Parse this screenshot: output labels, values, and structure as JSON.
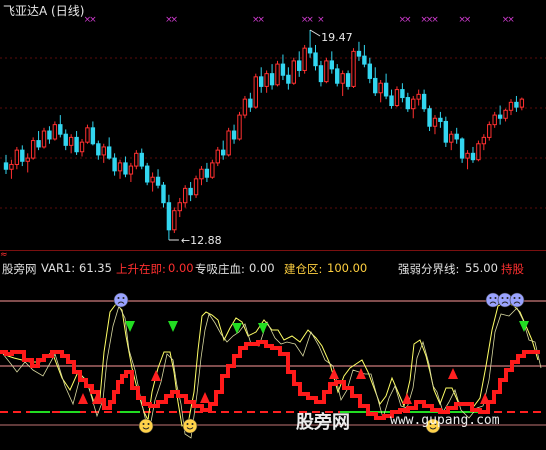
{
  "header": {
    "stock_name": "飞亚达A",
    "period": "(日线)"
  },
  "price_chart": {
    "high_label": "19.47",
    "low_label": "12.88",
    "colors": {
      "up": "#ff3030",
      "down": "#33d6f0",
      "marker": "#d03cd0"
    },
    "candles": [
      [
        15.3,
        15.55,
        14.95,
        15.1
      ],
      [
        15.1,
        15.4,
        14.8,
        15.25
      ],
      [
        15.25,
        15.8,
        15.1,
        15.7
      ],
      [
        15.7,
        15.85,
        15.2,
        15.35
      ],
      [
        15.35,
        15.6,
        15.0,
        15.45
      ],
      [
        15.45,
        16.1,
        15.4,
        16.0
      ],
      [
        16.0,
        16.3,
        15.7,
        15.8
      ],
      [
        15.8,
        16.4,
        15.75,
        16.3
      ],
      [
        16.3,
        16.45,
        15.9,
        16.05
      ],
      [
        16.05,
        16.6,
        16.0,
        16.5
      ],
      [
        16.5,
        16.8,
        16.1,
        16.2
      ],
      [
        16.2,
        16.35,
        15.7,
        15.85
      ],
      [
        15.85,
        16.2,
        15.6,
        16.1
      ],
      [
        16.1,
        16.3,
        15.55,
        15.65
      ],
      [
        15.65,
        16.05,
        15.5,
        15.95
      ],
      [
        15.95,
        16.5,
        15.9,
        16.4
      ],
      [
        16.4,
        16.6,
        15.85,
        15.9
      ],
      [
        15.9,
        16.0,
        15.4,
        15.55
      ],
      [
        15.55,
        15.9,
        15.3,
        15.8
      ],
      [
        15.8,
        16.1,
        15.4,
        15.45
      ],
      [
        15.45,
        15.6,
        14.9,
        15.05
      ],
      [
        15.05,
        15.4,
        14.8,
        15.3
      ],
      [
        15.3,
        15.5,
        14.85,
        14.95
      ],
      [
        14.95,
        15.3,
        14.7,
        15.2
      ],
      [
        15.2,
        15.7,
        15.1,
        15.6
      ],
      [
        15.6,
        15.75,
        15.1,
        15.2
      ],
      [
        15.2,
        15.3,
        14.6,
        14.7
      ],
      [
        14.7,
        15.0,
        14.4,
        14.85
      ],
      [
        14.85,
        15.1,
        14.5,
        14.6
      ],
      [
        14.6,
        14.7,
        13.9,
        14.05
      ],
      [
        14.05,
        14.3,
        12.88,
        13.2
      ],
      [
        13.2,
        13.9,
        13.1,
        13.8
      ],
      [
        13.8,
        14.2,
        13.6,
        14.05
      ],
      [
        14.05,
        14.6,
        13.9,
        14.5
      ],
      [
        14.5,
        14.7,
        14.1,
        14.3
      ],
      [
        14.3,
        14.9,
        14.2,
        14.8
      ],
      [
        14.8,
        15.2,
        14.6,
        15.1
      ],
      [
        15.1,
        15.3,
        14.7,
        14.85
      ],
      [
        14.85,
        15.4,
        14.8,
        15.3
      ],
      [
        15.3,
        15.8,
        15.2,
        15.7
      ],
      [
        15.7,
        16.0,
        15.4,
        15.55
      ],
      [
        15.55,
        16.4,
        15.5,
        16.3
      ],
      [
        16.3,
        16.5,
        15.9,
        16.05
      ],
      [
        16.05,
        16.9,
        16.0,
        16.8
      ],
      [
        16.8,
        17.4,
        16.7,
        17.3
      ],
      [
        17.3,
        17.5,
        16.9,
        17.05
      ],
      [
        17.05,
        18.1,
        17.0,
        18.0
      ],
      [
        18.0,
        18.3,
        17.5,
        17.7
      ],
      [
        17.7,
        18.2,
        17.5,
        18.1
      ],
      [
        18.1,
        18.4,
        17.6,
        17.75
      ],
      [
        17.75,
        18.5,
        17.7,
        18.4
      ],
      [
        18.4,
        18.7,
        17.9,
        18.05
      ],
      [
        18.05,
        18.3,
        17.6,
        17.8
      ],
      [
        17.8,
        18.6,
        17.75,
        18.5
      ],
      [
        18.5,
        18.8,
        18.0,
        18.2
      ],
      [
        18.2,
        19.0,
        18.1,
        18.9
      ],
      [
        18.9,
        19.47,
        18.6,
        18.75
      ],
      [
        18.75,
        19.0,
        18.2,
        18.35
      ],
      [
        18.35,
        18.5,
        17.7,
        17.85
      ],
      [
        17.85,
        18.6,
        17.8,
        18.5
      ],
      [
        18.5,
        18.8,
        18.1,
        18.25
      ],
      [
        18.25,
        18.4,
        17.7,
        17.8
      ],
      [
        17.8,
        18.2,
        17.4,
        18.1
      ],
      [
        18.1,
        18.2,
        17.6,
        17.7
      ],
      [
        17.7,
        18.9,
        17.65,
        18.8
      ],
      [
        18.8,
        19.1,
        18.5,
        18.65
      ],
      [
        18.65,
        19.0,
        18.3,
        18.4
      ],
      [
        18.4,
        18.6,
        17.8,
        17.95
      ],
      [
        17.95,
        18.3,
        17.4,
        17.5
      ],
      [
        17.5,
        17.9,
        17.2,
        17.8
      ],
      [
        17.8,
        18.1,
        17.3,
        17.4
      ],
      [
        17.4,
        17.6,
        17.0,
        17.1
      ],
      [
        17.1,
        17.7,
        17.05,
        17.6
      ],
      [
        17.6,
        17.8,
        17.2,
        17.35
      ],
      [
        17.35,
        17.5,
        16.9,
        17.0
      ],
      [
        17.0,
        17.4,
        16.7,
        17.3
      ],
      [
        17.3,
        17.6,
        17.1,
        17.45
      ],
      [
        17.45,
        17.6,
        16.9,
        17.0
      ],
      [
        17.0,
        17.1,
        16.3,
        16.45
      ],
      [
        16.45,
        16.8,
        16.2,
        16.7
      ],
      [
        16.7,
        16.9,
        16.4,
        16.6
      ],
      [
        16.6,
        16.75,
        15.8,
        15.95
      ],
      [
        15.95,
        16.3,
        15.7,
        16.2
      ],
      [
        16.2,
        16.4,
        15.9,
        16.05
      ],
      [
        16.05,
        16.1,
        15.3,
        15.45
      ],
      [
        15.45,
        15.7,
        15.1,
        15.6
      ],
      [
        15.6,
        15.8,
        15.3,
        15.4
      ],
      [
        15.4,
        16.0,
        15.35,
        15.9
      ],
      [
        15.9,
        16.2,
        15.7,
        16.1
      ],
      [
        16.1,
        16.6,
        16.0,
        16.5
      ],
      [
        16.5,
        16.9,
        16.4,
        16.8
      ],
      [
        16.8,
        17.1,
        16.5,
        16.7
      ],
      [
        16.7,
        17.0,
        16.6,
        16.95
      ],
      [
        16.95,
        17.3,
        16.8,
        17.2
      ],
      [
        17.2,
        17.4,
        16.9,
        17.05
      ],
      [
        17.05,
        17.35,
        16.95,
        17.3
      ]
    ],
    "buy_markers": [
      15,
      16,
      30,
      31,
      46,
      47,
      55,
      56,
      58,
      73,
      74,
      77,
      78,
      79,
      84,
      85,
      92,
      93
    ]
  },
  "indicator": {
    "site_label": "股旁网",
    "var1_label": "VAR1:",
    "var1_value": "61.35",
    "rise_label": "上升在即:",
    "rise_value": "0.00",
    "absorb_label": "专吸庄血:",
    "absorb_value": "0.00",
    "build_label": "建仓区:",
    "build_value": "100.00",
    "strength_label": "强弱分界线:",
    "strength_value": "55.00",
    "hold_label": "持股",
    "colors": {
      "base": "#e0e0e0",
      "rise": "#ff3030",
      "absorb": "#e0e0e0",
      "build": "#ffd040",
      "strength": "#e0e0e0",
      "hold": "#ff3030",
      "line": "#ffff66",
      "step": "#ff1a1a",
      "hline": "#ff9a9a",
      "green": "#22dd22"
    }
  },
  "watermark": {
    "text": "股旁网",
    "url": "www.gupang.com"
  },
  "red_marker": "≈"
}
